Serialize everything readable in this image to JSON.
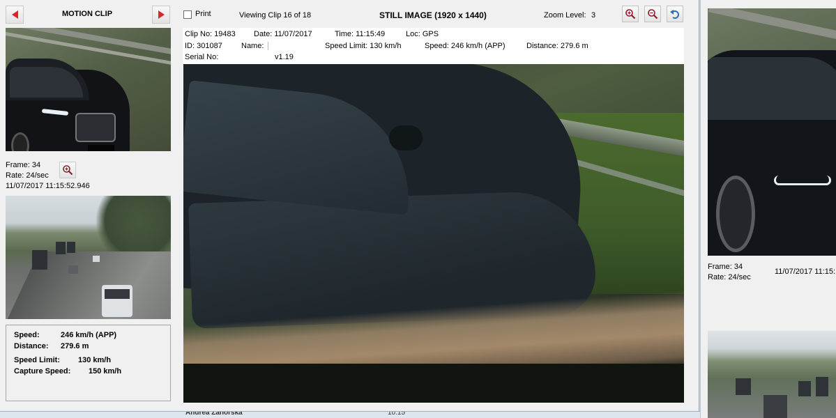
{
  "left_panel": {
    "title": "MOTION CLIP",
    "frame_label": "Frame: 34",
    "rate_label": "Rate: 24/sec",
    "timestamp": "11/07/2017 11:15:52.946",
    "details": {
      "speed_label": "Speed:",
      "speed_value": "246 km/h (APP)",
      "distance_label": "Distance:",
      "distance_value": "279.6 m",
      "speed_limit_label": "Speed Limit:",
      "speed_limit_value": "130 km/h",
      "capture_speed_label": "Capture Speed:",
      "capture_speed_value": "150 km/h"
    }
  },
  "toolbar": {
    "print_label": "Print",
    "viewing_clip": "Viewing Clip 16 of 18",
    "still_title": "STILL IMAGE (1920 x 1440)",
    "zoom_label": "Zoom Level:",
    "zoom_value": "3"
  },
  "info": {
    "clip_no": "Clip No: 19483",
    "date": "Date: 11/07/2017",
    "time": "Time: 11:15:49",
    "loc": "Loc: GPS",
    "id": "ID: 301087",
    "name": "Name:",
    "speed_limit": "Speed Limit: 130 km/h",
    "speed": "Speed: 246 km/h (APP)",
    "distance": "Distance: 279.6 m",
    "serial": "Serial No:",
    "version": "v1.19"
  },
  "second_window": {
    "frame_label": "Frame: 34",
    "rate_label": "Rate: 24/sec",
    "timestamp": "11/07/2017 11:15:"
  },
  "taskbar": {
    "name": "Andrea Záhorská",
    "time": "10:15"
  },
  "colors": {
    "nav_arrow": "#d8262b",
    "window_bg": "#f0f0f0"
  },
  "icons": [
    "previous-arrow-icon",
    "next-arrow-icon",
    "zoom-in-icon",
    "zoom-out-icon",
    "undo-icon"
  ]
}
